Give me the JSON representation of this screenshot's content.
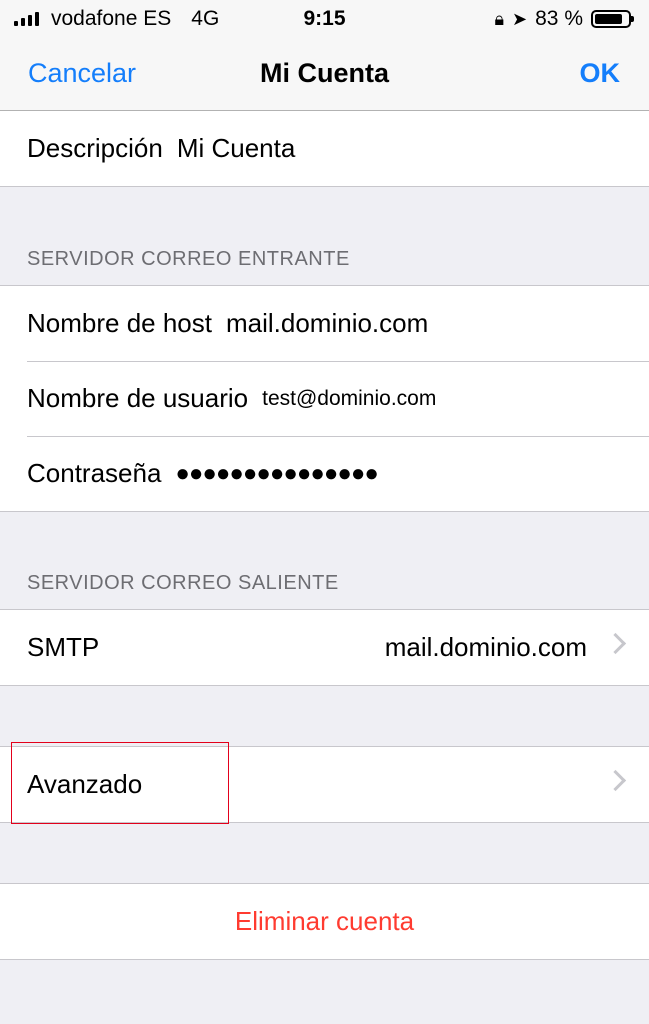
{
  "status_bar": {
    "carrier": "vodafone ES",
    "network": "4G",
    "time": "9:15",
    "battery": "83 %",
    "battery_level": 0.83
  },
  "nav": {
    "cancel_label": "Cancelar",
    "title": "Mi Cuenta",
    "ok_label": "OK"
  },
  "account": {
    "description_label": "Descripción",
    "description_value": "Mi Cuenta"
  },
  "incoming": {
    "header": "SERVIDOR CORREO ENTRANTE",
    "host_label": "Nombre de host",
    "host_value": "mail.dominio.com",
    "user_label": "Nombre de usuario",
    "user_value": "test@dominio.com",
    "password_label": "Contraseña",
    "password_value": "●●●●●●●●●●●●●●●"
  },
  "outgoing": {
    "header": "SERVIDOR CORREO SALIENTE",
    "smtp_label": "SMTP",
    "smtp_value": "mail.dominio.com"
  },
  "advanced": {
    "label": "Avanzado"
  },
  "delete": {
    "label": "Eliminar cuenta"
  },
  "colors": {
    "accent": "#147efb",
    "destructive": "#ff3b30",
    "highlight_box": "#e3001b"
  }
}
